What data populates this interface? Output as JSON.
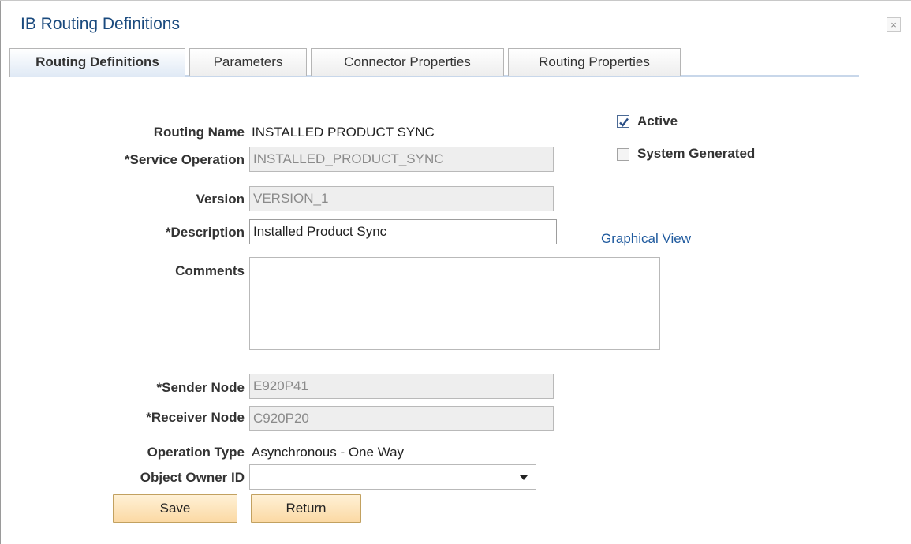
{
  "window": {
    "title": "IB Routing Definitions",
    "close_glyph": "×"
  },
  "tabs": [
    {
      "label": "Routing Definitions",
      "active": true
    },
    {
      "label": "Parameters",
      "active": false
    },
    {
      "label": "Connector Properties",
      "active": false
    },
    {
      "label": "Routing Properties",
      "active": false
    }
  ],
  "form": {
    "routing_name": {
      "label": "Routing Name",
      "value": "INSTALLED PRODUCT SYNC"
    },
    "service_operation": {
      "label": "*Service Operation",
      "value": "INSTALLED_PRODUCT_SYNC"
    },
    "version": {
      "label": "Version",
      "value": "VERSION_1"
    },
    "description": {
      "label": "*Description",
      "value": "Installed Product Sync"
    },
    "comments": {
      "label": "Comments",
      "value": ""
    },
    "sender_node": {
      "label": "*Sender Node",
      "value": "E920P41"
    },
    "receiver_node": {
      "label": "*Receiver Node",
      "value": "C920P20"
    },
    "operation_type": {
      "label": "Operation Type",
      "value": "Asynchronous - One Way"
    },
    "object_owner_id": {
      "label": "Object Owner ID",
      "value": ""
    }
  },
  "options": {
    "active": {
      "label": "Active",
      "checked": true
    },
    "system_generated": {
      "label": "System Generated",
      "checked": false
    }
  },
  "links": {
    "graphical_view": "Graphical View"
  },
  "buttons": {
    "save": "Save",
    "return": "Return"
  },
  "colors": {
    "title": "#1a4a7e",
    "link": "#1f5a9e",
    "button": "#fbd9a4",
    "tab_active": "#dfe9f5"
  },
  "icons": {
    "close": "close-icon",
    "checkbox": "checkmark-icon",
    "dropdown": "chevron-down-icon"
  }
}
